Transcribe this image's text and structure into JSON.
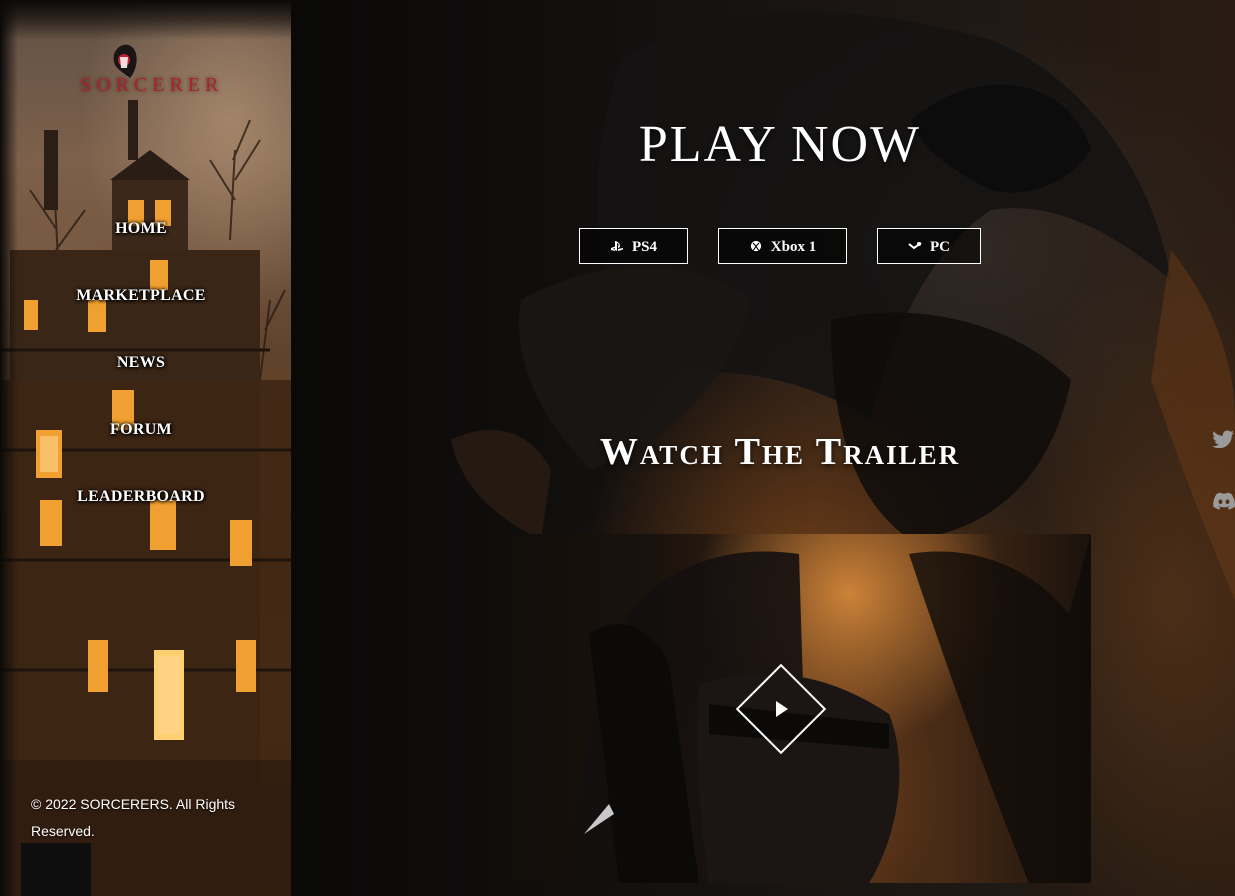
{
  "sidebar": {
    "logo_text": "SORCERER",
    "nav": [
      {
        "label": "HOME"
      },
      {
        "label": "MARKETPLACE"
      },
      {
        "label": "NEWS"
      },
      {
        "label": "FORUM"
      },
      {
        "label": "LEADERBOARD"
      }
    ],
    "copyright": "© 2022 SORCERERS. All Rights Reserved."
  },
  "hero": {
    "title": "PLAY NOW",
    "platforms": [
      {
        "label": "PS4",
        "icon": "playstation-icon"
      },
      {
        "label": "Xbox 1",
        "icon": "xbox-icon"
      },
      {
        "label": "PC",
        "icon": "steam-icon"
      }
    ]
  },
  "trailer": {
    "title": "Watch The Trailer",
    "play_icon": "play-icon"
  },
  "social": [
    {
      "icon": "twitter-icon"
    },
    {
      "icon": "discord-icon"
    }
  ],
  "colors": {
    "logo_red": "#b0202a",
    "text": "#ffffff",
    "background": "#0b0908"
  }
}
